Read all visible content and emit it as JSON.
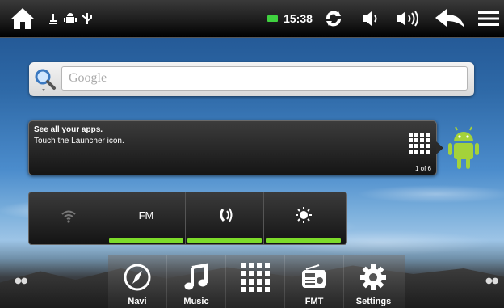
{
  "status_bar": {
    "time": "15:38",
    "icons": [
      "home-icon",
      "usb-debug-icon",
      "android-debug-icon",
      "usb-icon",
      "battery-icon",
      "sync-icon",
      "volume-down-icon",
      "volume-up-icon",
      "back-icon",
      "menu-icon"
    ]
  },
  "search": {
    "placeholder": "Google",
    "icon": "search-icon"
  },
  "launcher_hint": {
    "title": "See all your apps.",
    "body": "Touch the Launcher icon.",
    "page": "1 of 6"
  },
  "power_widget": {
    "buttons": [
      {
        "name": "wifi",
        "label": "",
        "active": false
      },
      {
        "name": "fm",
        "label": "FM",
        "active": true
      },
      {
        "name": "sync",
        "label": "",
        "active": true
      },
      {
        "name": "brightness",
        "label": "",
        "active": true
      }
    ]
  },
  "dock": {
    "items": [
      {
        "label": "Navi",
        "icon": "compass-icon"
      },
      {
        "label": "Music",
        "icon": "music-note-icon"
      },
      {
        "label": "",
        "icon": "app-grid-icon"
      },
      {
        "label": "FMT",
        "icon": "radio-icon"
      },
      {
        "label": "Settings",
        "icon": "gear-icon"
      }
    ]
  },
  "colors": {
    "accent_green": "#7ddb2a",
    "battery_green": "#3fd13f"
  }
}
